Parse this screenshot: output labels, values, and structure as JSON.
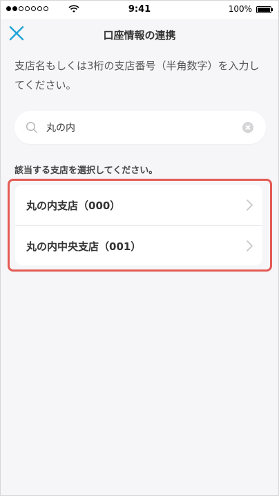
{
  "status_bar": {
    "time": "9:41",
    "battery": "100%",
    "battery_level": 1.0
  },
  "header": {
    "title": "口座情報の連携",
    "close_icon": "close-icon"
  },
  "instruction": {
    "text": "支店名もしくは3桁の支店番号（半角数字）を入力してください。"
  },
  "search": {
    "value": "丸の内",
    "icon": "search-icon",
    "clear_icon": "clear-icon"
  },
  "results": {
    "label": "該当する支店を選択してください。",
    "items": [
      {
        "name": "丸の内支店（000）"
      },
      {
        "name": "丸の内中央支店（001）"
      }
    ]
  },
  "colors": {
    "accent": "#1fa3d8",
    "highlight_border": "#e35a53"
  }
}
